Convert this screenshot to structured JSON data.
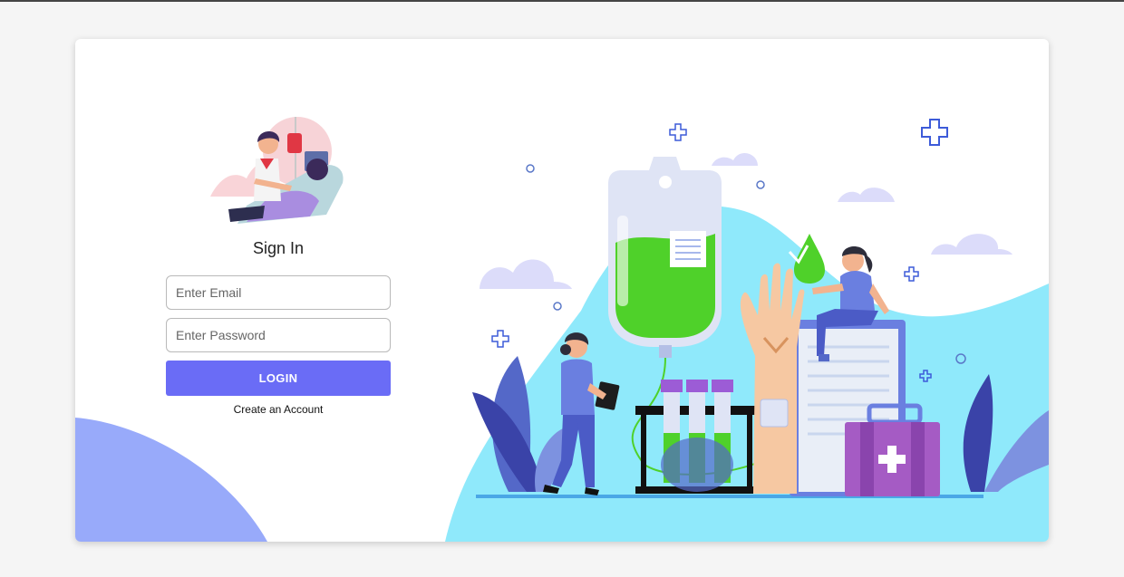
{
  "login_form": {
    "title": "Sign In",
    "email_placeholder": "Enter Email",
    "password_placeholder": "Enter Password",
    "login_label": "LOGIN",
    "create_account_label": "Create an Account"
  },
  "colors": {
    "accent": "#6a6cf6",
    "hero_background": "#8fe9fb",
    "left_blob": "#98aafa",
    "iv_fluid": "#4fd12a"
  },
  "icons": [
    "blood-donation-logo-icon",
    "medical-cross-icon",
    "first-aid-kit-icon",
    "water-drop-icon"
  ]
}
